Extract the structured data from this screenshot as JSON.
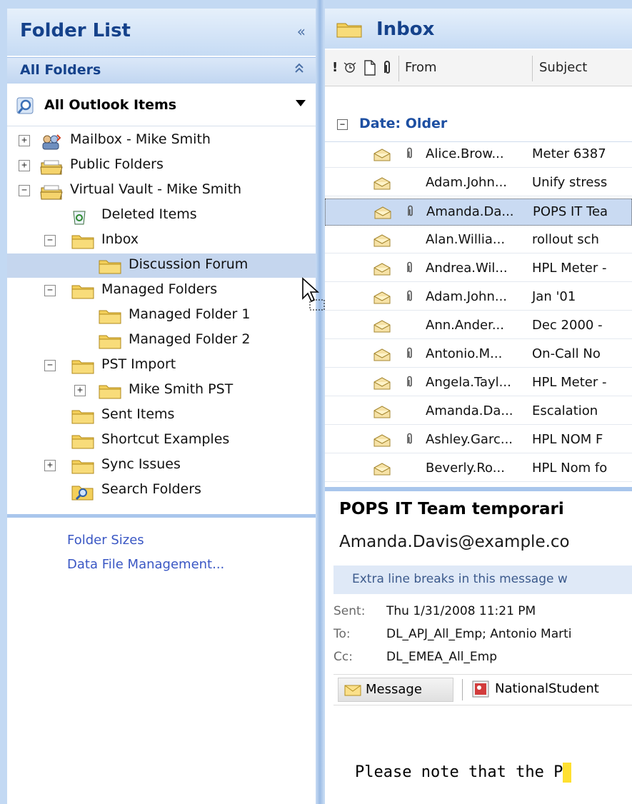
{
  "folder_list": {
    "title": "Folder List",
    "collapse_glyph": "«",
    "all_folders": "All Folders",
    "all_folders_glyph": "⌃",
    "view_selector": "All Outlook Items",
    "tree": [
      {
        "label": "Mailbox - Mike Smith",
        "expander": "+",
        "icon": "mailbox-icon"
      },
      {
        "label": "Public Folders",
        "expander": "+",
        "icon": "public-folders-icon"
      },
      {
        "label": "Virtual Vault - Mike Smith",
        "expander": "−",
        "icon": "vault-icon"
      },
      {
        "label": "Deleted Items",
        "expander": "",
        "icon": "deleted-items-icon"
      },
      {
        "label": "Inbox",
        "expander": "−",
        "icon": "folder-icon"
      },
      {
        "label": "Discussion Forum",
        "expander": "",
        "icon": "folder-icon",
        "selected": true
      },
      {
        "label": "Managed Folders",
        "expander": "−",
        "icon": "folder-icon"
      },
      {
        "label": "Managed Folder 1",
        "expander": "",
        "icon": "folder-icon"
      },
      {
        "label": "Managed Folder 2",
        "expander": "",
        "icon": "folder-icon"
      },
      {
        "label": "PST Import",
        "expander": "−",
        "icon": "folder-icon"
      },
      {
        "label": "Mike Smith PST",
        "expander": "+",
        "icon": "folder-icon"
      },
      {
        "label": "Sent Items",
        "expander": "",
        "icon": "folder-icon"
      },
      {
        "label": "Shortcut Examples",
        "expander": "",
        "icon": "folder-icon"
      },
      {
        "label": "Sync Issues",
        "expander": "+",
        "icon": "folder-icon"
      },
      {
        "label": "Search Folders",
        "expander": "",
        "icon": "search-folder-icon"
      }
    ],
    "links": [
      "Folder Sizes",
      "Data File Management..."
    ]
  },
  "inbox": {
    "title": "Inbox",
    "columns": {
      "importance": "!",
      "reminder": "⍾",
      "type": "🗋",
      "attachment": "0",
      "from": "From",
      "subject": "Subject"
    },
    "group_label": "Date: Older",
    "group_toggle": "−",
    "messages": [
      {
        "from": "Alice.Brow...",
        "subject": "Meter 6387",
        "attachment": true
      },
      {
        "from": "Adam.John...",
        "subject": "Unify stress",
        "attachment": false
      },
      {
        "from": "Amanda.Da...",
        "subject": "POPS IT Tea",
        "attachment": true,
        "selected": true
      },
      {
        "from": "Alan.Willia...",
        "subject": "rollout sch",
        "attachment": false
      },
      {
        "from": "Andrea.Wil...",
        "subject": "HPL Meter -",
        "attachment": true
      },
      {
        "from": "Adam.John...",
        "subject": "Jan '01",
        "attachment": true
      },
      {
        "from": "Ann.Ander...",
        "subject": "Dec 2000 -",
        "attachment": false
      },
      {
        "from": "Antonio.M...",
        "subject": "On-Call No",
        "attachment": true
      },
      {
        "from": "Angela.Tayl...",
        "subject": "HPL Meter -",
        "attachment": true
      },
      {
        "from": "Amanda.Da...",
        "subject": "Escalation",
        "attachment": false
      },
      {
        "from": "Ashley.Garc...",
        "subject": "HPL NOM F",
        "attachment": true
      },
      {
        "from": "Beverly.Ro...",
        "subject": "HPL Nom fo",
        "attachment": false
      }
    ]
  },
  "reading_pane": {
    "subject": "POPS IT Team temporari",
    "from": "Amanda.Davis@example.co",
    "info_bar": "Extra line breaks in this message w",
    "sent_label": "Sent:",
    "sent_value": "Thu 1/31/2008 11:21 PM",
    "to_label": "To:",
    "to_value": "DL_APJ_All_Emp; Antonio Marti",
    "cc_label": "Cc:",
    "cc_value": "DL_EMEA_All_Emp",
    "attachments": {
      "message_label": "Message",
      "file_label": "NationalStudent"
    },
    "body": "Please note that the P"
  },
  "colors": {
    "header_text": "#15428b",
    "selection": "#c5d6ee",
    "link": "#3a57c4",
    "accent": "#a9c6ec"
  }
}
